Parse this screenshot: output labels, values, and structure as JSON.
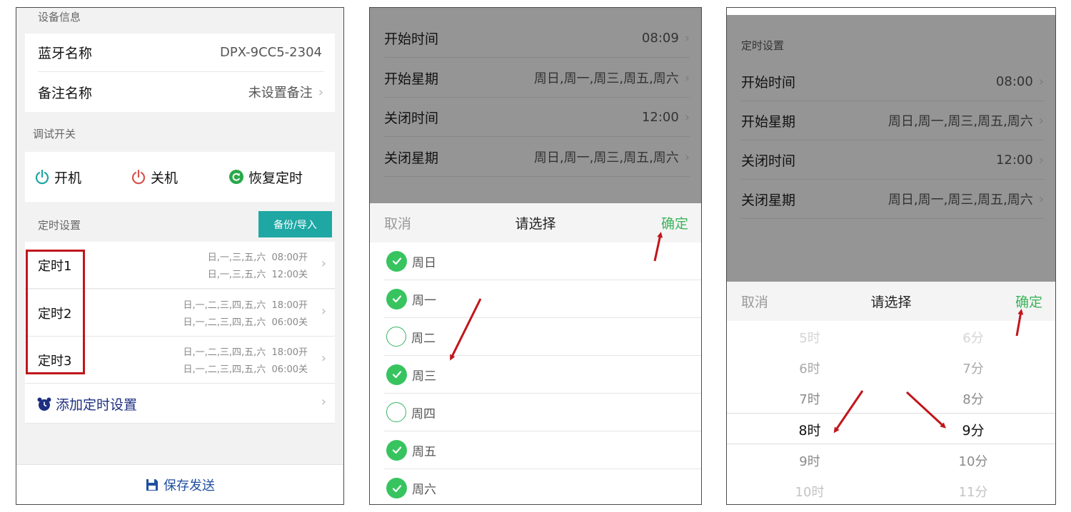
{
  "panel1": {
    "device_section": "设备信息",
    "bt_label": "蓝牙名称",
    "bt_value": "DPX-9CC5-2304",
    "note_label": "备注名称",
    "note_value": "未设置备注",
    "debug_section": "调试开关",
    "power_on": "开机",
    "power_off": "关机",
    "restore": "恢复定时",
    "timer_section": "定时设置",
    "backup_button": "备份/导入",
    "timers": [
      {
        "name": "定时1",
        "on_days": "日,一,三,五,六",
        "on_time": "08:00开",
        "off_days": "日,一,三,五,六",
        "off_time": "12:00关"
      },
      {
        "name": "定时2",
        "on_days": "日,一,二,三,四,五,六",
        "on_time": "18:00开",
        "off_days": "日,一,二,三,四,五,六",
        "off_time": "06:00关"
      },
      {
        "name": "定时3",
        "on_days": "日,一,二,三,四,五,六",
        "on_time": "18:00开",
        "off_days": "日,一,二,三,四,五,六",
        "off_time": "06:00关"
      }
    ],
    "add_timer": "添加定时设置",
    "save_send": "保存发送"
  },
  "panel2": {
    "rows": [
      {
        "label": "开始时间",
        "value": "08:09"
      },
      {
        "label": "开始星期",
        "value": "周日,周一,周三,周五,周六"
      },
      {
        "label": "关闭时间",
        "value": "12:00"
      },
      {
        "label": "关闭星期",
        "value": "周日,周一,周三,周五,周六"
      }
    ],
    "cancel": "取消",
    "title": "请选择",
    "ok": "确定",
    "days": [
      {
        "label": "周日",
        "checked": true
      },
      {
        "label": "周一",
        "checked": true
      },
      {
        "label": "周二",
        "checked": false
      },
      {
        "label": "周三",
        "checked": true
      },
      {
        "label": "周四",
        "checked": false
      },
      {
        "label": "周五",
        "checked": true
      },
      {
        "label": "周六",
        "checked": true
      }
    ]
  },
  "panel3": {
    "section": "定时设置",
    "rows": [
      {
        "label": "开始时间",
        "value": "08:00"
      },
      {
        "label": "开始星期",
        "value": "周日,周一,周三,周五,周六"
      },
      {
        "label": "关闭时间",
        "value": "12:00"
      },
      {
        "label": "关闭星期",
        "value": "周日,周一,周三,周五,周六"
      }
    ],
    "cancel": "取消",
    "title": "请选择",
    "ok": "确定",
    "hours": [
      "5时",
      "6时",
      "7时",
      "8时",
      "9时",
      "10时"
    ],
    "minutes": [
      "6分",
      "7分",
      "8分",
      "9分",
      "10分",
      "11分"
    ],
    "selected_hour": "8时",
    "selected_minute": "9分"
  },
  "colors": {
    "accent_green": "#3cb35a",
    "teal": "#1fa7a4",
    "annotation_red": "#c0161c",
    "save_blue": "#1f4fa0"
  }
}
